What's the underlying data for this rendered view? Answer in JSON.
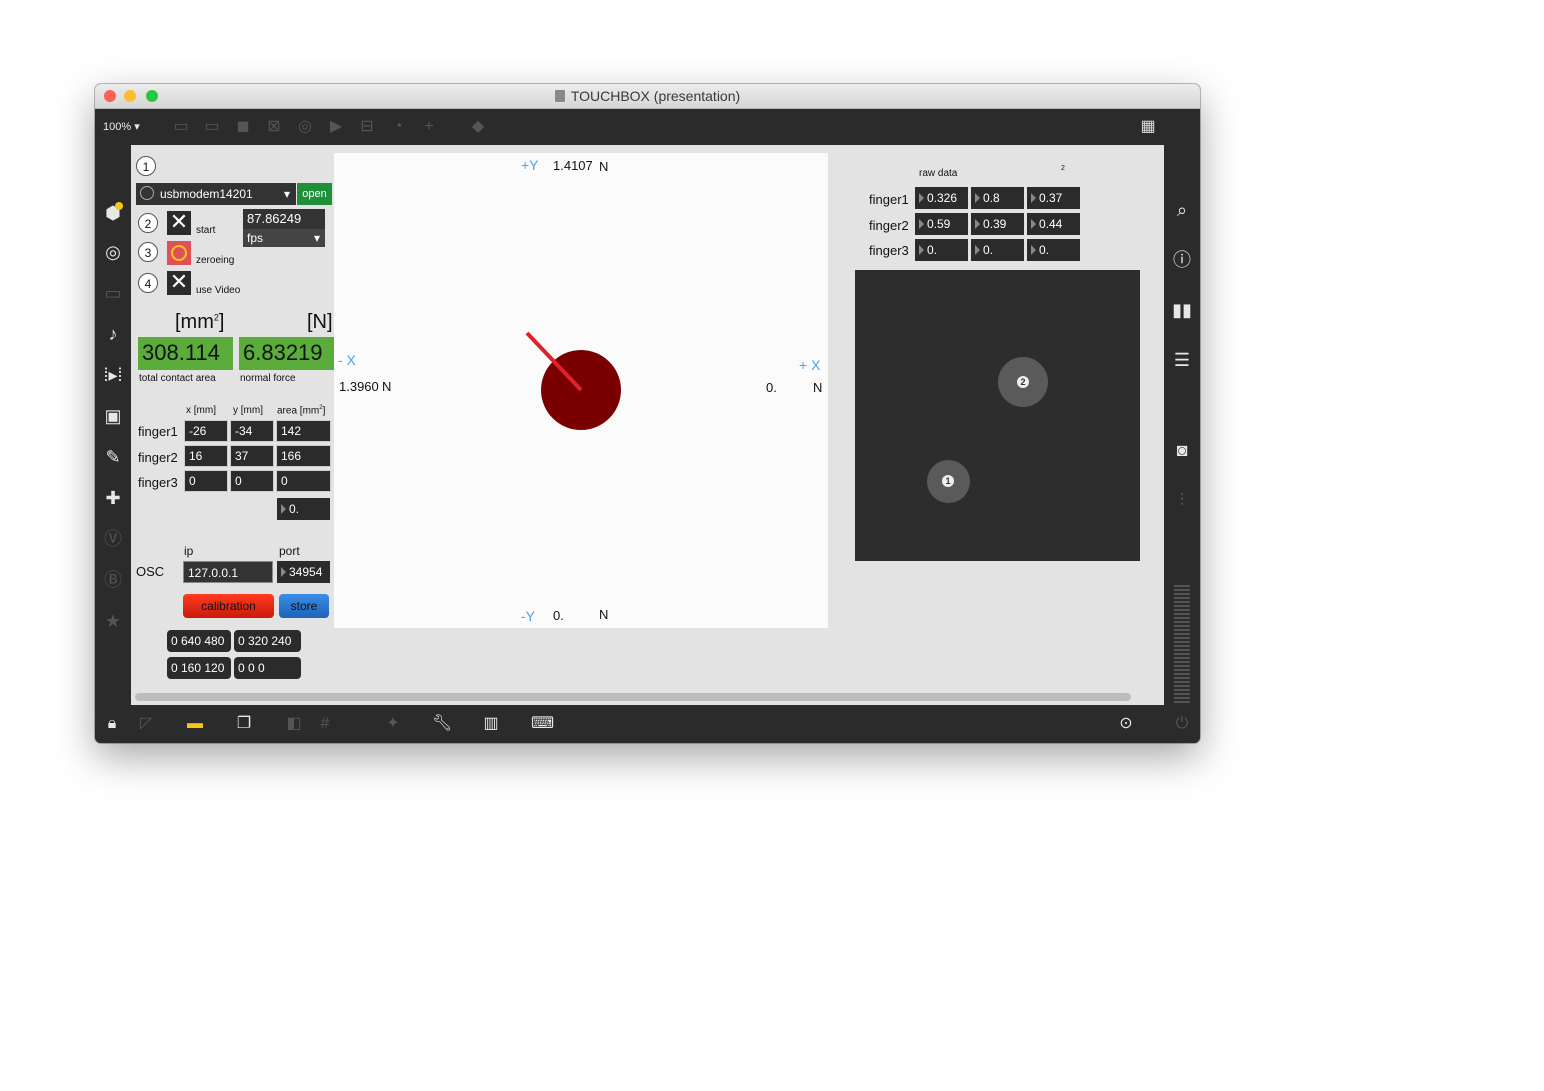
{
  "window": {
    "title": "TOUCHBOX (presentation)"
  },
  "toolbar": {
    "zoom": "100%",
    "zoom_arrow": "▾"
  },
  "serial": {
    "step": "1",
    "port": "usbmodem14201",
    "open_label": "open"
  },
  "controls": {
    "start": {
      "step": "2",
      "label": "start"
    },
    "zeroing": {
      "step": "3",
      "label": "zeroeing"
    },
    "video": {
      "step": "4",
      "label": "use Video"
    },
    "fps_value": "87.86249",
    "fps_unit": "fps"
  },
  "totals": {
    "area_unit": "[mm",
    "area_unit_sup": "2",
    "area_unit_close": "]",
    "force_unit": "[N]",
    "area_value": "308.114",
    "force_value": "6.83219",
    "area_label": "total contact area",
    "force_label": "normal force"
  },
  "finger_table": {
    "headers": {
      "x": "x [mm]",
      "y": "y [mm]",
      "area": "area  [mm",
      "area_sup": "2",
      "area_close": "]"
    },
    "rows": [
      {
        "label": "finger1",
        "x": "-26",
        "y": "-34",
        "area": "142"
      },
      {
        "label": "finger2",
        "x": "16",
        "y": "37",
        "area": "166"
      },
      {
        "label": "finger3",
        "x": "0",
        "y": "0",
        "area": "0"
      }
    ],
    "extra_value": "0."
  },
  "osc": {
    "label": "OSC",
    "ip_label": "ip",
    "port_label": "port",
    "ip": "127.0.0.1",
    "port": "34954"
  },
  "buttons": {
    "calibration": "calibration",
    "store": "store"
  },
  "messages": [
    "0 640 480",
    "0 320 240",
    "0 160 120",
    "0 0 0"
  ],
  "force_panel": {
    "plus_y": "+Y",
    "plus_y_value": "1.4107",
    "plus_y_unit": "N",
    "minus_x": "- X",
    "minus_x_value": "1.3960",
    "minus_x_unit": "N",
    "plus_x": "+ X",
    "plus_x_value": "0.",
    "plus_x_unit": "N",
    "minus_y": "-Y",
    "minus_y_value": "0.",
    "minus_y_unit": "N"
  },
  "raw_data": {
    "title": "raw data",
    "sup": "2",
    "rows": [
      {
        "label": "finger1",
        "values": [
          "0.326",
          "0.8",
          "0.37"
        ]
      },
      {
        "label": "finger2",
        "values": [
          "0.59",
          "0.39",
          "0.44"
        ]
      },
      {
        "label": "finger3",
        "values": [
          "0.",
          "0.",
          "0."
        ]
      }
    ]
  },
  "finger_view": {
    "marker1": "1",
    "marker2": "2"
  },
  "colors": {
    "green": "#5aad3a",
    "dark_red": "#7a0000",
    "red_line": "#e0202a",
    "blue_axis": "#4aa3f0"
  }
}
